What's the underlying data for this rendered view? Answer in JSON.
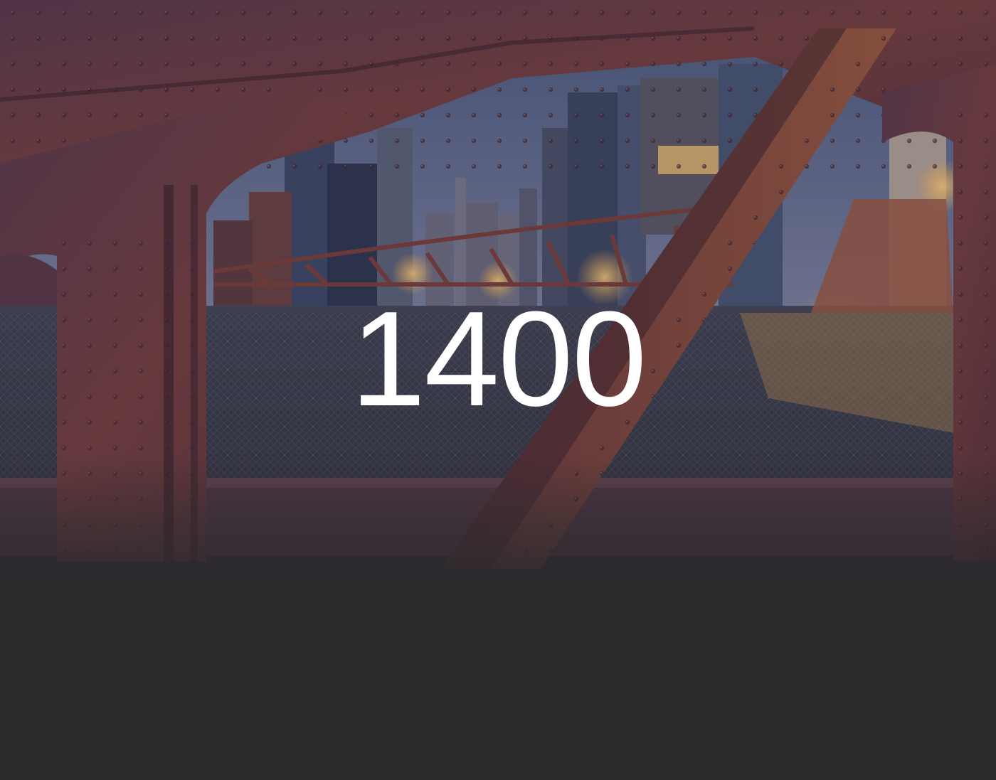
{
  "hero": {
    "number": "1400",
    "scene": "bridge-truss-city-view"
  },
  "colors": {
    "steel": "#6b3a3c",
    "steel_dark": "#3e2429",
    "sky": "#5a6a86",
    "lights": "#e8a84a",
    "deck": "#3c3f49",
    "bottom_panel": "#2d2b2e",
    "text": "#ffffff"
  }
}
